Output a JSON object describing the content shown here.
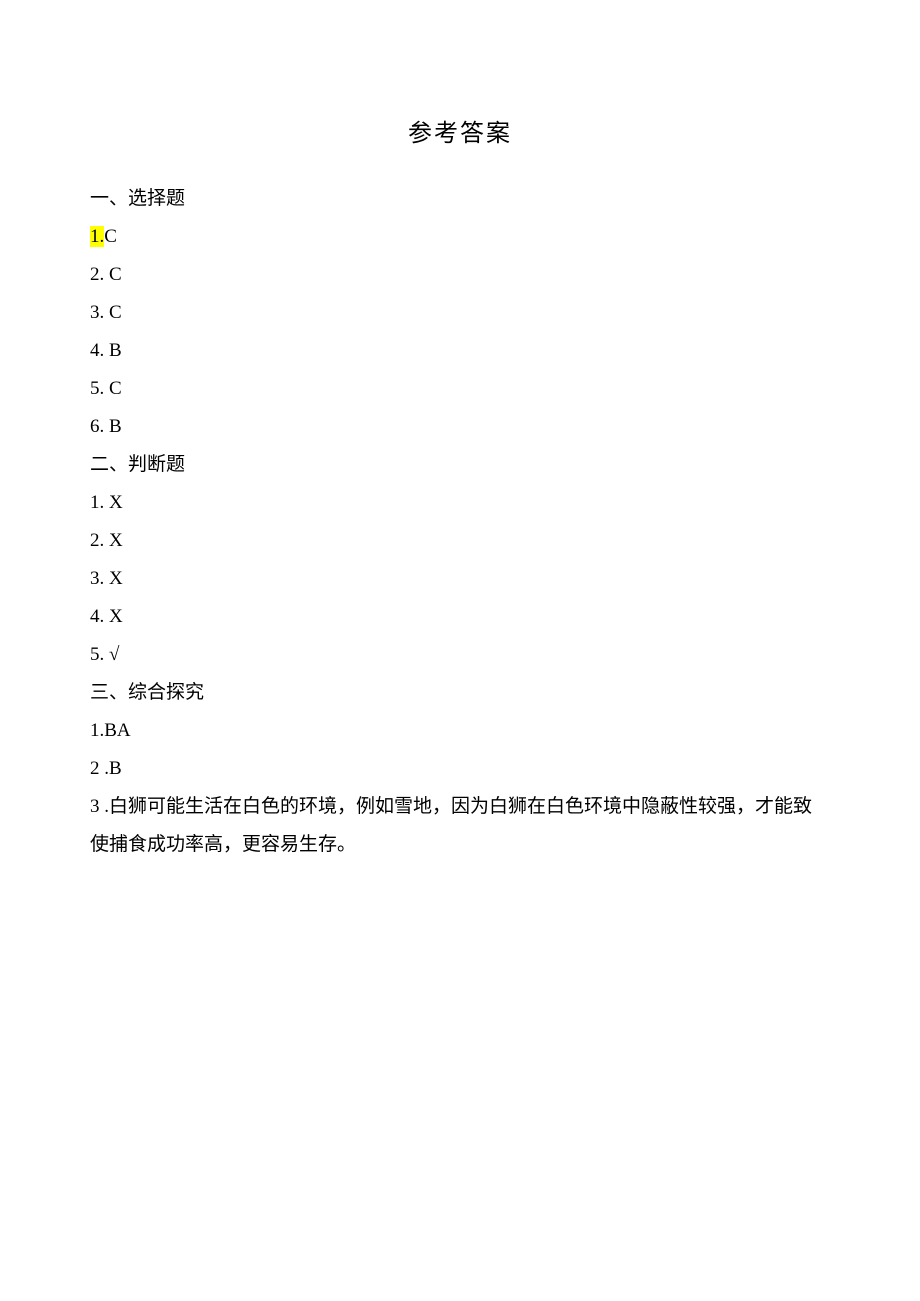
{
  "title": "参考答案",
  "sections": {
    "s1": {
      "heading": "一、选择题",
      "items": [
        {
          "num": "1.",
          "answer": "C",
          "highlighted": true
        },
        {
          "num": "2.",
          "answer": "C",
          "highlighted": false
        },
        {
          "num": "3.",
          "answer": "C",
          "highlighted": false
        },
        {
          "num": "4.",
          "answer": "B",
          "highlighted": false
        },
        {
          "num": "5.",
          "answer": "C",
          "highlighted": false
        },
        {
          "num": "6.",
          "answer": "B",
          "highlighted": false
        }
      ]
    },
    "s2": {
      "heading": "二、判断题",
      "items": [
        {
          "num": "1.",
          "answer": "X"
        },
        {
          "num": "2.",
          "answer": "X"
        },
        {
          "num": "3.",
          "answer": "X"
        },
        {
          "num": "4.",
          "answer": "X"
        },
        {
          "num": "5.",
          "answer": "√"
        }
      ]
    },
    "s3": {
      "heading": "三、综合探究",
      "items": [
        {
          "num": "1.",
          "answer": "BA"
        },
        {
          "num": "2",
          "sep": " .",
          "answer": "B"
        },
        {
          "num": "3",
          "sep": " .",
          "answer": "白狮可能生活在白色的环境，例如雪地，因为白狮在白色环境中隐蔽性较强，才能致使捕食成功率高，更容易生存。"
        }
      ]
    }
  }
}
